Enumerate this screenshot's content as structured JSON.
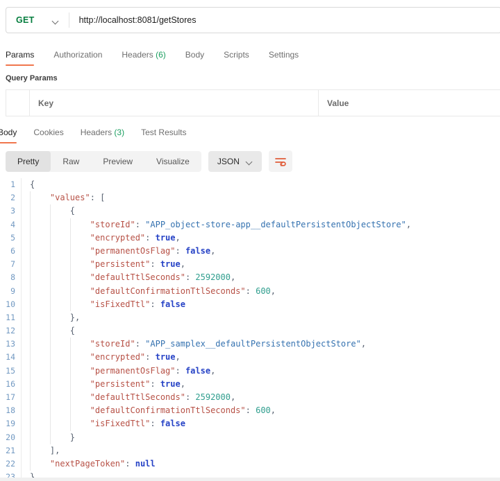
{
  "request": {
    "method": "GET",
    "url": "http://localhost:8081/getStores",
    "tabs": [
      {
        "label": "Params",
        "active": true
      },
      {
        "label": "Authorization"
      },
      {
        "label": "Headers",
        "count": "(6)"
      },
      {
        "label": "Body"
      },
      {
        "label": "Scripts"
      },
      {
        "label": "Settings"
      }
    ],
    "query_params": {
      "section_title": "Query Params",
      "columns": [
        "Key",
        "Value"
      ]
    }
  },
  "response": {
    "tabs": [
      {
        "label": "Body",
        "active": true
      },
      {
        "label": "Cookies"
      },
      {
        "label": "Headers",
        "count": "(3)"
      },
      {
        "label": "Test Results"
      }
    ],
    "view_modes": [
      {
        "label": "Pretty",
        "active": true
      },
      {
        "label": "Raw"
      },
      {
        "label": "Preview"
      },
      {
        "label": "Visualize"
      }
    ],
    "format": "JSON",
    "wrap_icon": "wrap-text-icon",
    "body_lines": [
      {
        "i": 0,
        "t": [
          [
            "p",
            "{"
          ]
        ]
      },
      {
        "i": 1,
        "t": [
          [
            "k",
            "\"values\""
          ],
          [
            "p",
            ": ["
          ]
        ]
      },
      {
        "i": 2,
        "t": [
          [
            "p",
            "{"
          ]
        ]
      },
      {
        "i": 3,
        "t": [
          [
            "k",
            "\"storeId\""
          ],
          [
            "p",
            ": "
          ],
          [
            "s",
            "\"APP_object-store-app__defaultPersistentObjectStore\""
          ],
          [
            "p",
            ","
          ]
        ]
      },
      {
        "i": 3,
        "t": [
          [
            "k",
            "\"encrypted\""
          ],
          [
            "p",
            ": "
          ],
          [
            "b",
            "true"
          ],
          [
            "p",
            ","
          ]
        ]
      },
      {
        "i": 3,
        "t": [
          [
            "k",
            "\"permanentOsFlag\""
          ],
          [
            "p",
            ": "
          ],
          [
            "b",
            "false"
          ],
          [
            "p",
            ","
          ]
        ]
      },
      {
        "i": 3,
        "t": [
          [
            "k",
            "\"persistent\""
          ],
          [
            "p",
            ": "
          ],
          [
            "b",
            "true"
          ],
          [
            "p",
            ","
          ]
        ]
      },
      {
        "i": 3,
        "t": [
          [
            "k",
            "\"defaultTtlSeconds\""
          ],
          [
            "p",
            ": "
          ],
          [
            "n",
            "2592000"
          ],
          [
            "p",
            ","
          ]
        ]
      },
      {
        "i": 3,
        "t": [
          [
            "k",
            "\"defaultConfirmationTtlSeconds\""
          ],
          [
            "p",
            ": "
          ],
          [
            "n",
            "600"
          ],
          [
            "p",
            ","
          ]
        ]
      },
      {
        "i": 3,
        "t": [
          [
            "k",
            "\"isFixedTtl\""
          ],
          [
            "p",
            ": "
          ],
          [
            "b",
            "false"
          ]
        ]
      },
      {
        "i": 2,
        "t": [
          [
            "p",
            "},"
          ]
        ]
      },
      {
        "i": 2,
        "t": [
          [
            "p",
            "{"
          ]
        ]
      },
      {
        "i": 3,
        "t": [
          [
            "k",
            "\"storeId\""
          ],
          [
            "p",
            ": "
          ],
          [
            "s",
            "\"APP_samplex__defaultPersistentObjectStore\""
          ],
          [
            "p",
            ","
          ]
        ]
      },
      {
        "i": 3,
        "t": [
          [
            "k",
            "\"encrypted\""
          ],
          [
            "p",
            ": "
          ],
          [
            "b",
            "true"
          ],
          [
            "p",
            ","
          ]
        ]
      },
      {
        "i": 3,
        "t": [
          [
            "k",
            "\"permanentOsFlag\""
          ],
          [
            "p",
            ": "
          ],
          [
            "b",
            "false"
          ],
          [
            "p",
            ","
          ]
        ]
      },
      {
        "i": 3,
        "t": [
          [
            "k",
            "\"persistent\""
          ],
          [
            "p",
            ": "
          ],
          [
            "b",
            "true"
          ],
          [
            "p",
            ","
          ]
        ]
      },
      {
        "i": 3,
        "t": [
          [
            "k",
            "\"defaultTtlSeconds\""
          ],
          [
            "p",
            ": "
          ],
          [
            "n",
            "2592000"
          ],
          [
            "p",
            ","
          ]
        ]
      },
      {
        "i": 3,
        "t": [
          [
            "k",
            "\"defaultConfirmationTtlSeconds\""
          ],
          [
            "p",
            ": "
          ],
          [
            "n",
            "600"
          ],
          [
            "p",
            ","
          ]
        ]
      },
      {
        "i": 3,
        "t": [
          [
            "k",
            "\"isFixedTtl\""
          ],
          [
            "p",
            ": "
          ],
          [
            "b",
            "false"
          ]
        ]
      },
      {
        "i": 2,
        "t": [
          [
            "p",
            "}"
          ]
        ]
      },
      {
        "i": 1,
        "t": [
          [
            "p",
            "],"
          ]
        ]
      },
      {
        "i": 1,
        "t": [
          [
            "k",
            "\"nextPageToken\""
          ],
          [
            "p",
            ": "
          ],
          [
            "b",
            "null"
          ]
        ]
      },
      {
        "i": 0,
        "t": [
          [
            "p",
            "}"
          ]
        ]
      }
    ]
  },
  "colors": {
    "method_green": "#067e3f",
    "count_green": "#1a9e5f",
    "accent_orange": "#f0764d",
    "wrap_icon_orange": "#e05b38",
    "json_key": "#b75146",
    "json_string": "#3572b0",
    "json_boolean": "#2743c6",
    "json_number": "#2f9e8e",
    "line_number_blue": "#7299c2"
  }
}
